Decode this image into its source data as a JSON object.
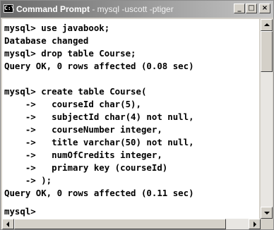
{
  "window": {
    "icon_label": "C:\\",
    "title": "Command Prompt",
    "title_rest": " - mysql -uscott -ptiger",
    "buttons": {
      "minimize": "_",
      "maximize": "□",
      "close": "×"
    }
  },
  "console": {
    "lines": [
      "mysql> use javabook;",
      "Database changed",
      "mysql> drop table Course;",
      "Query OK, 0 rows affected (0.08 sec)",
      "",
      "mysql> create table Course(",
      "    ->   courseId char(5),",
      "    ->   subjectId char(4) not null,",
      "    ->   courseNumber integer,",
      "    ->   title varchar(50) not null,",
      "    ->   numOfCredits integer,",
      "    ->   primary key (courseId)",
      "    -> );",
      "Query OK, 0 rows affected (0.11 sec)",
      "",
      "mysql>"
    ]
  },
  "colors": {
    "titlebar_start": "#6b6b6b",
    "titlebar_end": "#c6c6c6",
    "console_bg": "#ffffff",
    "console_text": "#000000",
    "chrome": "#d4d0c8"
  }
}
